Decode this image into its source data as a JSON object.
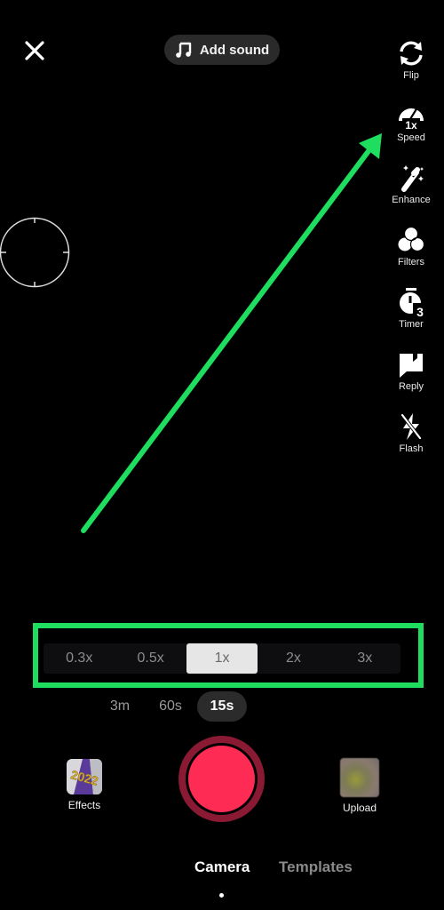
{
  "top_bar": {
    "close_icon": "close-icon",
    "add_sound": {
      "icon": "music-note-icon",
      "label": "Add sound"
    }
  },
  "side_tools": [
    {
      "id": "flip",
      "icon": "flip-camera-icon",
      "label": "Flip"
    },
    {
      "id": "speed",
      "icon": "speed-gauge-icon",
      "label": "Speed",
      "badge": "1x"
    },
    {
      "id": "enhance",
      "icon": "magic-wand-icon",
      "label": "Enhance"
    },
    {
      "id": "filters",
      "icon": "filters-icon",
      "label": "Filters"
    },
    {
      "id": "timer",
      "icon": "timer-icon",
      "label": "Timer",
      "badge": "3"
    },
    {
      "id": "reply",
      "icon": "reply-icon",
      "label": "Reply"
    },
    {
      "id": "flash",
      "icon": "flash-off-icon",
      "label": "Flash"
    }
  ],
  "focus": {
    "icon": "focus-ring-icon"
  },
  "annotation": {
    "color": "#1fdd5e",
    "arrow_target": "Speed",
    "highlight_target": "speed-selector"
  },
  "speed_options": {
    "items": [
      "0.3x",
      "0.5x",
      "1x",
      "2x",
      "3x"
    ],
    "selected": "1x"
  },
  "durations": {
    "items": [
      "3m",
      "60s",
      "15s"
    ],
    "selected": "15s"
  },
  "bottom": {
    "effects": {
      "label": "Effects",
      "thumb_text": "2022"
    },
    "upload": {
      "label": "Upload"
    },
    "record": {
      "color": "#fe2c55",
      "ring_color": "#8a1a33"
    }
  },
  "modes": {
    "items": [
      "Camera",
      "Templates"
    ],
    "selected": "Camera"
  }
}
